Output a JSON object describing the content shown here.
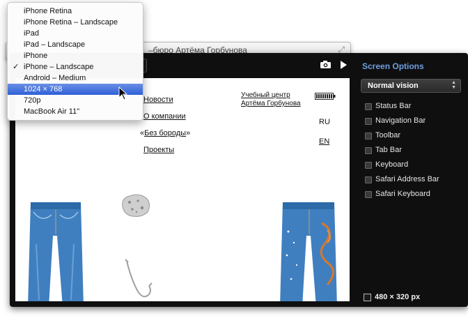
{
  "background_window": {
    "title": "–бюро Артёма Горбунова"
  },
  "device_menu": {
    "items": [
      {
        "label": "iPhone Retina",
        "checked": false,
        "highlighted": false
      },
      {
        "label": "iPhone Retina – Landscape",
        "checked": false,
        "highlighted": false
      },
      {
        "label": "iPad",
        "checked": false,
        "highlighted": false
      },
      {
        "label": "iPad – Landscape",
        "checked": false,
        "highlighted": false
      },
      {
        "label": "iPhone",
        "checked": false,
        "highlighted": false
      },
      {
        "label": "iPhone – Landscape",
        "checked": true,
        "highlighted": false
      },
      {
        "label": "Android – Medium",
        "checked": false,
        "highlighted": false
      },
      {
        "label": "1024 × 768",
        "checked": false,
        "highlighted": true
      },
      {
        "label": "720p",
        "checked": false,
        "highlighted": false
      },
      {
        "label": "MacBook Air 11\"",
        "checked": false,
        "highlighted": false
      }
    ],
    "check_mark": "✓",
    "highlight_color": "#2e5fd6"
  },
  "preview": {
    "nav": {
      "news": "Новости",
      "about": "О компании",
      "beardless_open": "«",
      "beardless": "Без бороды",
      "beardless_close": "»",
      "projects": "Проекты"
    },
    "brand_line1": "Учебный центр",
    "brand_line2": "Артёма Горбунова",
    "lang_ru": "RU",
    "lang_en": "EN"
  },
  "toolbar": {
    "icons": [
      "camera-icon",
      "play-icon"
    ]
  },
  "screen_options": {
    "title": "Screen Options",
    "title_color": "#6e9ee0",
    "vision_select": "Normal vision",
    "options": [
      {
        "label": "Status Bar",
        "checked": false
      },
      {
        "label": "Navigation Bar",
        "checked": false
      },
      {
        "label": "Toolbar",
        "checked": false
      },
      {
        "label": "Tab Bar",
        "checked": false
      },
      {
        "label": "Keyboard",
        "checked": false
      },
      {
        "label": "Safari Address Bar",
        "checked": false
      },
      {
        "label": "Safari Keyboard",
        "checked": false
      }
    ],
    "size_label": "480 × 320 px"
  }
}
